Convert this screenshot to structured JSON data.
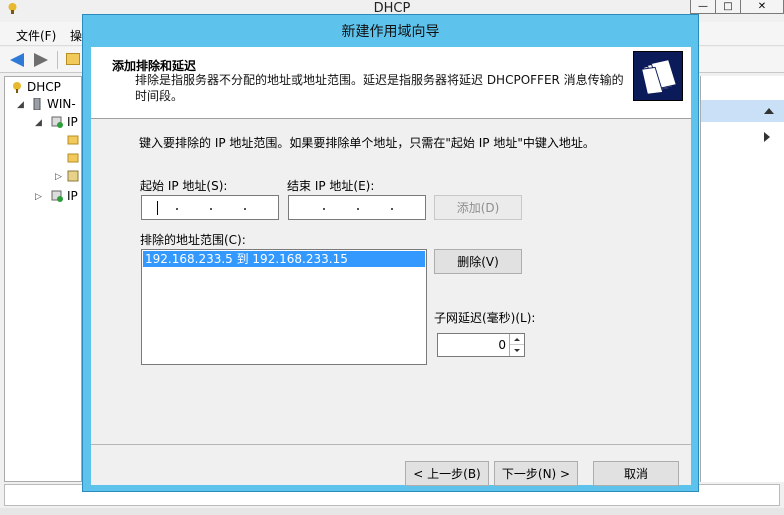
{
  "main_window": {
    "title": "DHCP",
    "menu": [
      "文件(F)",
      "操"
    ],
    "tree": {
      "root": "DHCP",
      "server": "WIN-",
      "ipv4": "IP",
      "ipv6": "IP"
    }
  },
  "dialog": {
    "title": "新建作用域向导",
    "header_title": "添加排除和延迟",
    "header_subtitle": "排除是指服务器不分配的地址或地址范围。延迟是指服务器将延迟 DHCPOFFER 消息传输的时间段。",
    "intro": "键入要排除的 IP 地址范围。如果要排除单个地址，只需在\"起始 IP 地址\"中键入地址。",
    "start_ip_label": "起始 IP 地址(S):",
    "end_ip_label": "结束 IP 地址(E):",
    "add_button": "添加(D)",
    "excluded_label": "排除的地址范围(C):",
    "excluded_items": [
      "192.168.233.5 到 192.168.233.15"
    ],
    "remove_button": "删除(V)",
    "delay_label": "子网延迟(毫秒)(L):",
    "delay_value": "0",
    "back_button": "< 上一步(B)",
    "next_button": "下一步(N) >",
    "cancel_button": "取消"
  }
}
